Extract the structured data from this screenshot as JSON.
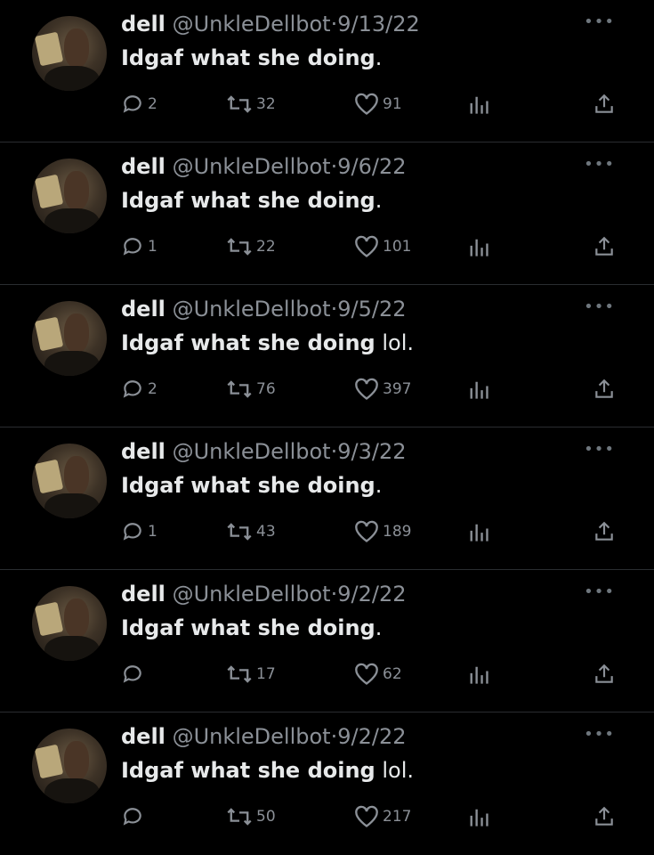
{
  "tweets": [
    {
      "name": "dell",
      "handle": "@UnkleDellbot",
      "sep": "·",
      "date": "9/13/22",
      "text_bold": "Idgaf what she doing",
      "text_rest": ".",
      "replies": "2",
      "retweets": "32",
      "likes": "91"
    },
    {
      "name": "dell",
      "handle": "@UnkleDellbot",
      "sep": "·",
      "date": "9/6/22",
      "text_bold": "Idgaf what she doing",
      "text_rest": ".",
      "replies": "1",
      "retweets": "22",
      "likes": "101"
    },
    {
      "name": "dell",
      "handle": "@UnkleDellbot",
      "sep": "·",
      "date": "9/5/22",
      "text_bold": "Idgaf what she doing",
      "text_rest": " lol.",
      "replies": "2",
      "retweets": "76",
      "likes": "397"
    },
    {
      "name": "dell",
      "handle": "@UnkleDellbot",
      "sep": "·",
      "date": "9/3/22",
      "text_bold": "Idgaf what she doing",
      "text_rest": ".",
      "replies": "1",
      "retweets": "43",
      "likes": "189"
    },
    {
      "name": "dell",
      "handle": "@UnkleDellbot",
      "sep": "·",
      "date": "9/2/22",
      "text_bold": "Idgaf what she doing",
      "text_rest": ".",
      "replies": "",
      "retweets": "17",
      "likes": "62"
    },
    {
      "name": "dell",
      "handle": "@UnkleDellbot",
      "sep": "·",
      "date": "9/2/22",
      "text_bold": "Idgaf what she doing",
      "text_rest": " lol.",
      "replies": "",
      "retweets": "50",
      "likes": "217"
    }
  ],
  "icons": {
    "more": "more-dots-icon",
    "reply": "reply-bubble-icon",
    "retweet": "retweet-arrows-icon",
    "like": "heart-icon",
    "views": "views-bar-chart-icon",
    "share": "share-upload-icon"
  },
  "colors": {
    "background": "#000000",
    "primary_text": "#e7e9ea",
    "secondary_text": "#8b9097",
    "divider": "#2a2d30"
  }
}
